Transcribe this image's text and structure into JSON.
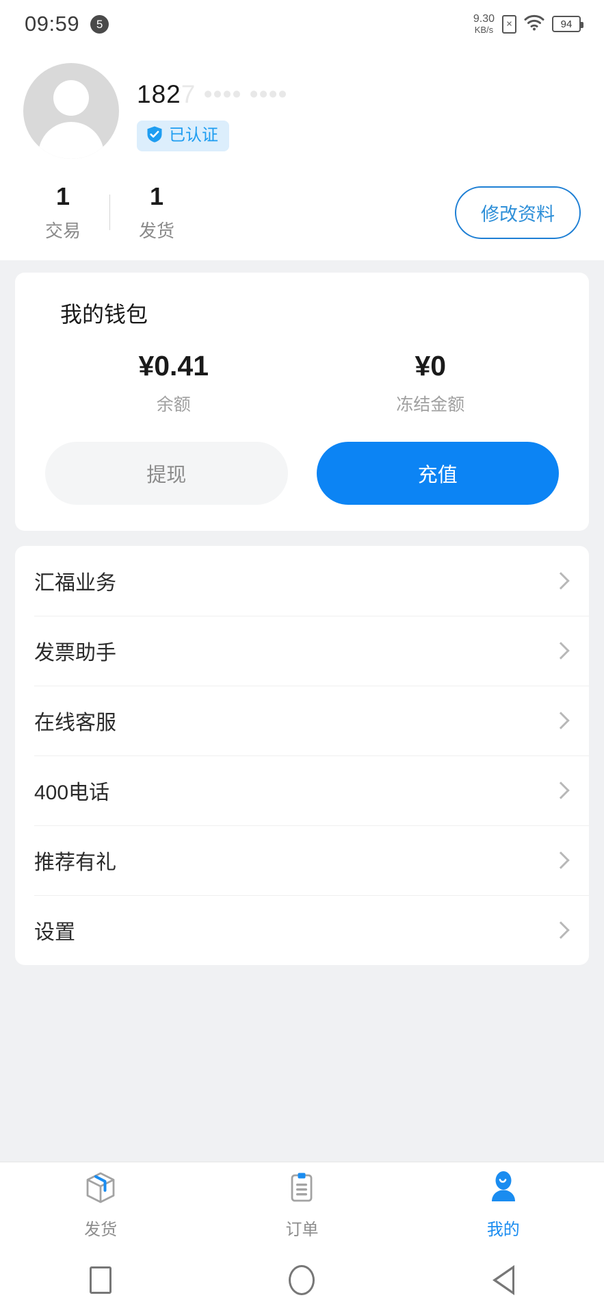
{
  "status_bar": {
    "time": "09:59",
    "alarm_count": "5",
    "net_speed_value": "9.30",
    "net_speed_unit": "KB/s",
    "battery_level": "94",
    "icons": [
      "alarm-icon",
      "sim-no-service-icon",
      "wifi-icon",
      "battery-icon"
    ]
  },
  "profile": {
    "username_visible": "182",
    "username_masked": "7 •••• ••••",
    "verified_badge": "已认证",
    "avatar": "default-user-avatar",
    "stats": [
      {
        "value": "1",
        "label": "交易"
      },
      {
        "value": "1",
        "label": "发货"
      }
    ],
    "edit_button": "修改资料"
  },
  "wallet": {
    "title": "我的钱包",
    "balance": {
      "amount": "¥0.41",
      "caption": "余额"
    },
    "frozen": {
      "amount": "¥0",
      "caption": "冻结金额"
    },
    "withdraw_label": "提现",
    "topup_label": "充值"
  },
  "menu": {
    "items": [
      {
        "label": "汇福业务"
      },
      {
        "label": "发票助手"
      },
      {
        "label": "在线客服"
      },
      {
        "label": "400电话"
      },
      {
        "label": "推荐有礼"
      },
      {
        "label": "设置"
      }
    ]
  },
  "tab_bar": {
    "tabs": [
      {
        "label": "发货",
        "icon": "package-box-icon",
        "active": false
      },
      {
        "label": "订单",
        "icon": "clipboard-list-icon",
        "active": false
      },
      {
        "label": "我的",
        "icon": "user-person-icon",
        "active": true
      }
    ]
  },
  "nav_bar": {
    "buttons": [
      "recents-square",
      "home-circle",
      "back-triangle"
    ]
  },
  "colors": {
    "accent_blue": "#0c84f4",
    "tab_active_blue": "#1a8cf0",
    "badge_blue": "#1e9df1",
    "badge_bg": "#dceefc",
    "page_bg": "#f0f1f3",
    "card_bg": "#ffffff",
    "muted_text": "#8a8a8a"
  }
}
